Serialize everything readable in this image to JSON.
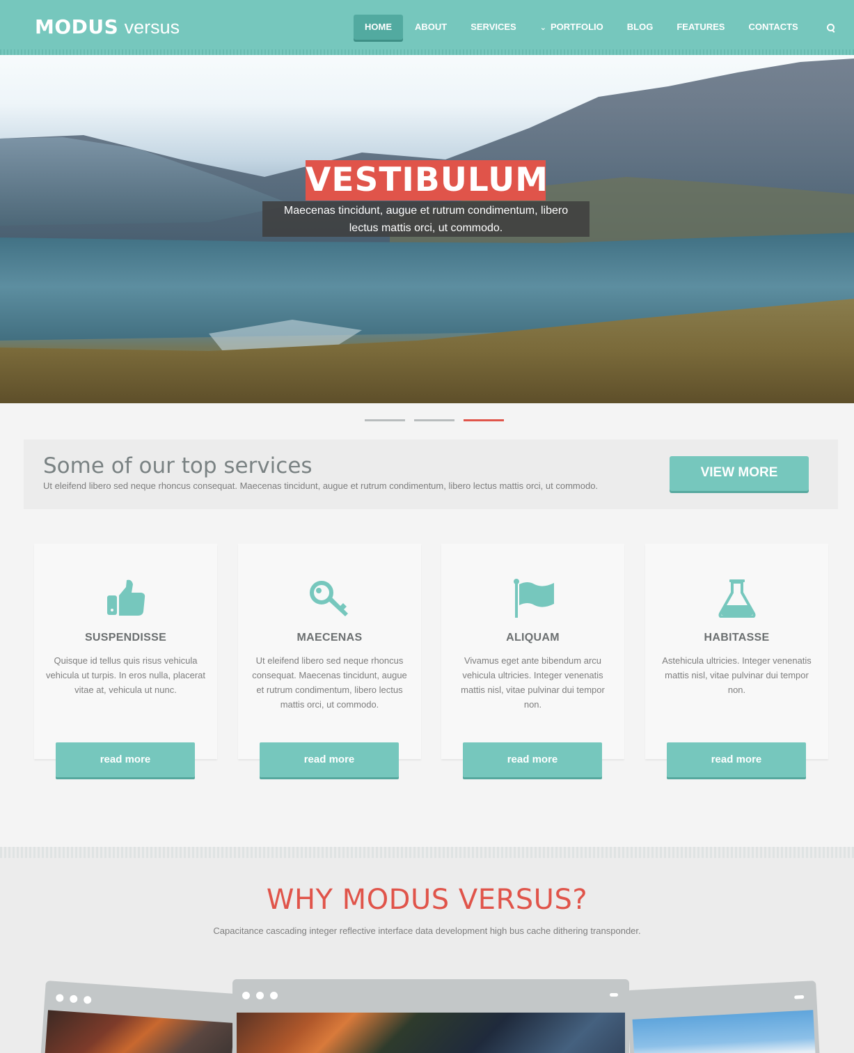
{
  "brand": {
    "bold": "MODUS",
    "light": "versus"
  },
  "nav": {
    "items": [
      {
        "label": "HOME",
        "active": true
      },
      {
        "label": "ABOUT"
      },
      {
        "label": "SERVICES"
      },
      {
        "label": "PORTFOLIO",
        "icon": "chevron-down-icon"
      },
      {
        "label": "BLOG"
      },
      {
        "label": "FEATURES"
      },
      {
        "label": "CONTACTS"
      }
    ],
    "search_icon": "search-icon"
  },
  "hero": {
    "title": "VESTIBULUM",
    "caption_line1": "Maecenas tincidunt, augue et rutrum condimentum, libero",
    "caption_line2": "lectus mattis orci, ut commodo.",
    "slides": 3,
    "active_slide": 3
  },
  "services": {
    "title": "Some of our top services",
    "text": "Ut eleifend libero sed neque rhoncus consequat. Maecenas tincidunt, augue et rutrum condimentum, libero lectus mattis orci, ut commodo.",
    "button": "VIEW MORE"
  },
  "cards": [
    {
      "icon": "thumbs-up-icon",
      "title": "SUSPENDISSE",
      "text": "Quisque id tellus quis risus vehicula vehicula ut turpis. In eros nulla, placerat vitae at, vehicula ut nunc.",
      "button": "read more"
    },
    {
      "icon": "key-icon",
      "title": "MAECENAS",
      "text": "Ut eleifend libero sed neque rhoncus consequat. Maecenas tincidunt, augue et rutrum condimentum, libero lectus mattis orci, ut commodo.",
      "button": "read more"
    },
    {
      "icon": "flag-icon",
      "title": "ALIQUAM",
      "text": "Vivamus eget ante bibendum arcu vehicula ultricies. Integer venenatis mattis nisl, vitae pulvinar dui tempor non.",
      "button": "read more"
    },
    {
      "icon": "flask-icon",
      "title": "HABITASSE",
      "text": "Astehicula ultricies. Integer venenatis mattis nisl, vitae pulvinar dui tempor non.",
      "button": "read more"
    }
  ],
  "why": {
    "title": "WHY MODUS VERSUS?",
    "subtitle": "Capacitance cascading integer reflective interface data development high bus cache dithering transponder."
  },
  "colors": {
    "accent": "#76c7bd",
    "red": "#e0544a"
  }
}
